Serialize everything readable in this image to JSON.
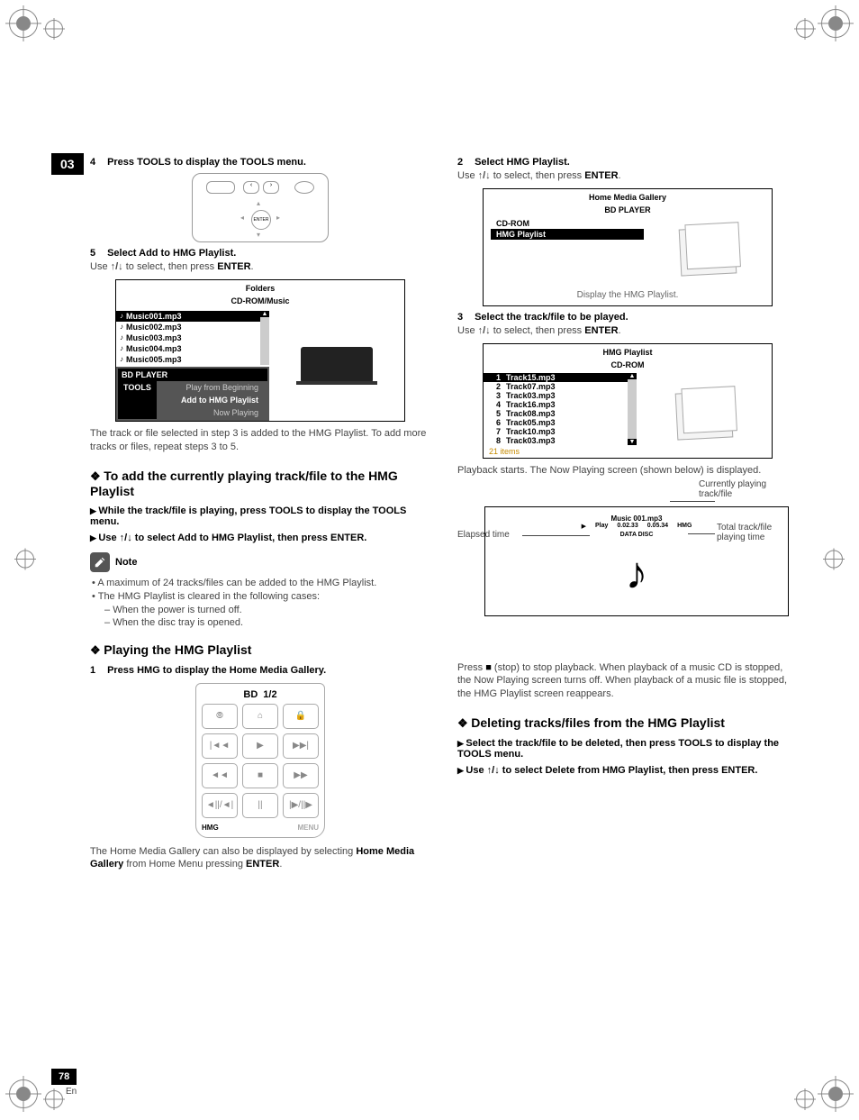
{
  "chapter": "03",
  "pageNumber": "78",
  "lang": "En",
  "left": {
    "step4": {
      "num": "4",
      "text": "Press TOOLS to display the TOOLS menu."
    },
    "remote1_enter": "ENTER",
    "step5": {
      "num": "5",
      "text": "Select Add to HMG Playlist."
    },
    "step5_body_pre": "Use ",
    "step5_body_arrows": "↑/↓",
    "step5_body_mid": " to select, then press ",
    "step5_body_enter": "ENTER",
    "step5_body_post": ".",
    "foldersBox": {
      "title": "Folders",
      "sub": "CD-ROM/Music",
      "files": [
        "Music001.mp3",
        "Music002.mp3",
        "Music003.mp3",
        "Music004.mp3",
        "Music005.mp3"
      ],
      "toolsHeader": "BD PLAYER",
      "toolsHeader2": "TOOLS",
      "opts": [
        "Play from Beginning",
        "Add to HMG Playlist",
        "Now Playing"
      ],
      "selectedOpt": 1
    },
    "afterFolders1": "The track or file selected in step 3 is added to the HMG Playlist. To add more tracks or files, repeat steps 3 to 5.",
    "h3a": "To add the currently playing track/file to the HMG Playlist",
    "triA": "While the track/file is playing, press TOOLS to display the TOOLS menu.",
    "triB_pre": "Use ",
    "triB_arrows": "↑/↓",
    "triB_post": " to select Add to HMG Playlist, then press ENTER.",
    "noteLabel": "Note",
    "note1": "A maximum of 24 tracks/files can be added to the HMG Playlist.",
    "note2": "The HMG Playlist is cleared in the following cases:",
    "note2a": "When the power is turned off.",
    "note2b": "When the disc tray is opened.",
    "h3b": "Playing the HMG Playlist",
    "step1": {
      "num": "1",
      "text": "Press HMG to display the Home Media Gallery."
    },
    "remote2": {
      "title_l": "BD",
      "title_r": "1/2",
      "row1": [
        "⦾",
        "⌂",
        "🔒"
      ],
      "row2": [
        "|◄◄",
        "▶",
        "▶▶|"
      ],
      "row3": [
        "◄◄",
        "■",
        "▶▶"
      ],
      "row4": [
        "◄||/◄|",
        "||",
        "|▶/||▶"
      ],
      "bl": "HMG",
      "br": "MENU"
    },
    "afterRemote_pre": "The Home Media Gallery can also be displayed by selecting ",
    "afterRemote_b1": "Home Media Gallery",
    "afterRemote_mid": " from Home Menu pressing ",
    "afterRemote_b2": "ENTER",
    "afterRemote_post": "."
  },
  "right": {
    "step2": {
      "num": "2",
      "text": "Select HMG Playlist."
    },
    "step2_body_pre": "Use ",
    "step2_arrows": "↑/↓",
    "step2_body_mid": " to select, then press ",
    "step2_enter": "ENTER",
    "step2_post": ".",
    "box1": {
      "title": "Home Media Gallery",
      "sub": "BD PLAYER",
      "tab1": "CD-ROM",
      "tab2": "HMG Playlist",
      "caption": "Display the HMG Playlist."
    },
    "step3": {
      "num": "3",
      "text": "Select the track/file to be played."
    },
    "step3_body_pre": "Use ",
    "step3_arrows": "↑/↓",
    "step3_body_mid": " to select, then press ",
    "step3_enter": "ENTER",
    "step3_post": ".",
    "box2": {
      "title": "HMG Playlist",
      "sub": "CD-ROM",
      "tracks": [
        {
          "n": "1",
          "t": "Track15.mp3"
        },
        {
          "n": "2",
          "t": "Track07.mp3"
        },
        {
          "n": "3",
          "t": "Track03.mp3"
        },
        {
          "n": "4",
          "t": "Track16.mp3"
        },
        {
          "n": "5",
          "t": "Track08.mp3"
        },
        {
          "n": "6",
          "t": "Track05.mp3"
        },
        {
          "n": "7",
          "t": "Track10.mp3"
        },
        {
          "n": "8",
          "t": "Track03.mp3"
        }
      ],
      "count": "21 items"
    },
    "afterBox2": "Playback starts. The Now Playing screen (shown below) is displayed.",
    "annot_cur": "Currently playing track/file",
    "annot_elapsed": "Elapsed time",
    "annot_total": "Total track/file playing time",
    "play": {
      "track": "Music 001.mp3",
      "playLabel": "Play",
      "elapsed": "0.02.33",
      "total": "0.05.34",
      "src": "HMG",
      "disc": "DATA DISC"
    },
    "afterPlay_pre": "Press ",
    "afterPlay_stop": "■",
    "afterPlay_post": " (stop) to stop playback. When playback of a music CD is stopped, the Now Playing screen turns off. When playback of a music file is stopped, the HMG Playlist screen reappears.",
    "h3c": "Deleting tracks/files from the HMG Playlist",
    "triC": "Select the track/file to be deleted, then press TOOLS to display the TOOLS menu.",
    "triD_pre": "Use ",
    "triD_arrows": "↑/↓",
    "triD_post": " to select Delete from HMG Playlist, then press ENTER."
  }
}
